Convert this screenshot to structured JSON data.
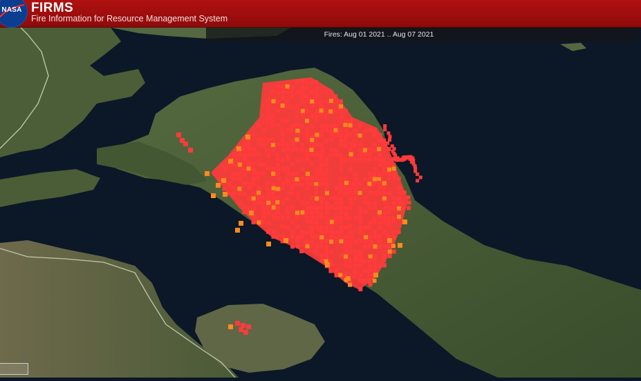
{
  "header": {
    "logo_text": "NASA",
    "title": "FIRMS",
    "subtitle": "Fire Information for Resource Management System"
  },
  "date_filter": {
    "label": "Fires: Aug 01 2021 .. Aug 07 2021"
  },
  "map": {
    "basemap": "satellite-imagery",
    "colors": {
      "sea": "#0b1626",
      "land": "#3f5330",
      "fire_recent": "#ff3b3b",
      "fire_older": "#ff8a1f"
    }
  }
}
